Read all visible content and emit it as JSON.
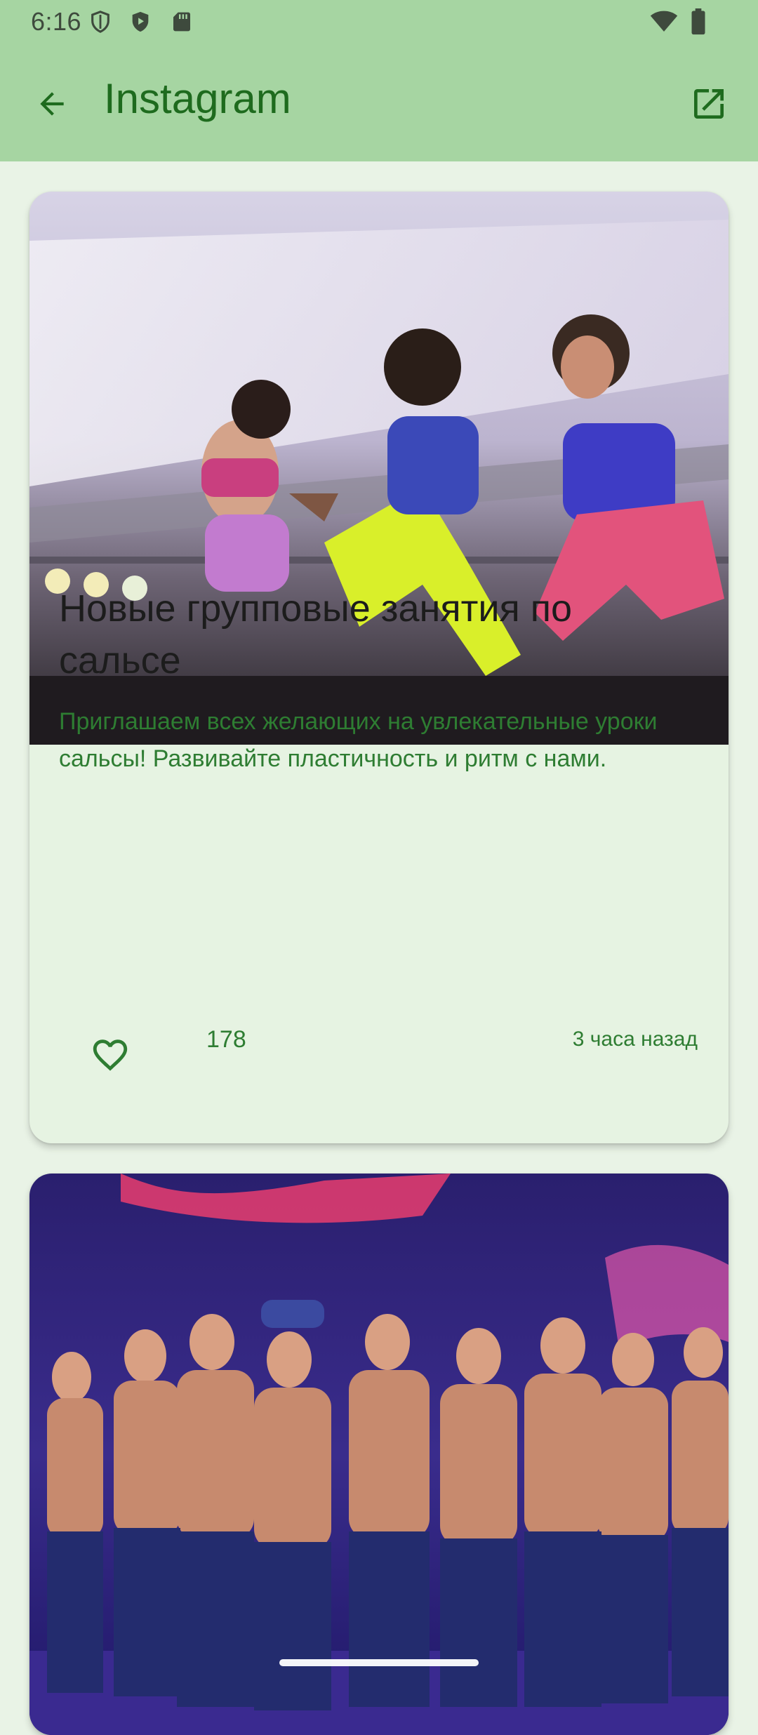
{
  "status_bar": {
    "time": "6:16",
    "icons": [
      "shield-icon",
      "play-protect-icon",
      "sd-card-icon",
      "wifi-icon",
      "battery-icon"
    ]
  },
  "app_bar": {
    "title": "Instagram",
    "back_icon": "arrow-back-icon",
    "action_icon": "open-in-new-icon"
  },
  "posts": [
    {
      "image": "dancers-jumping-photo",
      "title": "Новые групповые занятия по сальсе",
      "description": "Приглашаем всех желающих на увлекательные уроки сальсы! Развивайте пластичность и ритм с нами.",
      "likes": "178",
      "time": "3 часа назад",
      "like_icon": "heart-outline-icon"
    },
    {
      "image": "male-dancers-stage-photo"
    }
  ],
  "colors": {
    "app_bar_bg": "#a6d5a2",
    "page_bg": "#e9f3e6",
    "card_bg": "#e6f3e2",
    "accent_green": "#2e7d32",
    "title_green": "#1e6b1e"
  }
}
